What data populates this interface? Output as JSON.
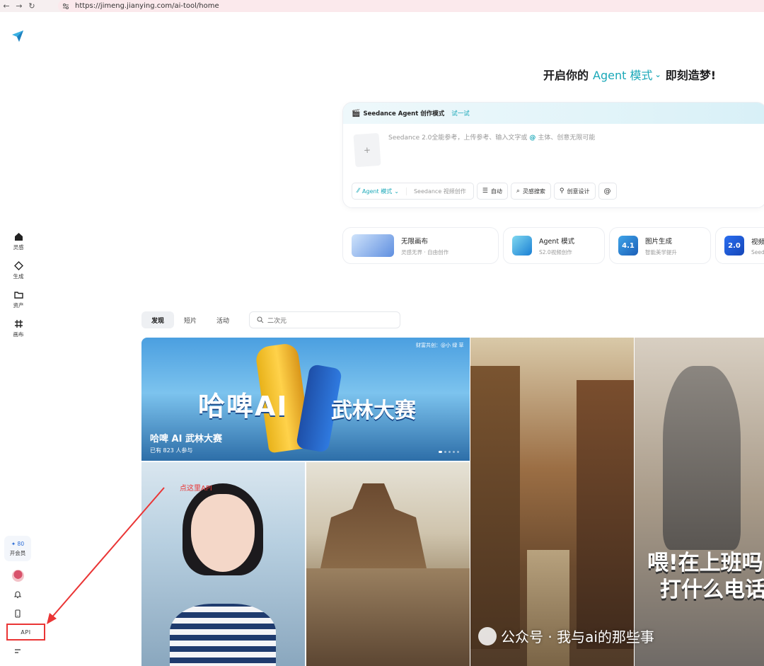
{
  "browser": {
    "url": "https://jimeng.jianying.com/ai-tool/home",
    "back_icon": "←",
    "forward_icon": "→",
    "reload_icon": "↻"
  },
  "sidebar": {
    "items": [
      {
        "label": "灵感",
        "icon": "home-icon"
      },
      {
        "label": "生成",
        "icon": "diamond-icon"
      },
      {
        "label": "资产",
        "icon": "folder-icon"
      },
      {
        "label": "画布",
        "icon": "canvas-icon"
      }
    ],
    "vip_count": "✦ 80",
    "vip_label": "开会员",
    "api_label": "API"
  },
  "hero": {
    "prefix": "开启你的",
    "accent": "Agent 模式",
    "suffix": "即刻造梦!",
    "accent_color": "#1aa8b8"
  },
  "prompt": {
    "banner_text": "Seedance Agent 创作模式",
    "banner_try": "试一试",
    "placeholder_a": "Seedance 2.0全能参考，上传参考、输入文字或",
    "placeholder_at": "@",
    "placeholder_b": "主体、创意无限可能",
    "upload_plus": "+",
    "tools": {
      "agent": "Agent 模式",
      "agent_sub": "Seedance 视频创作",
      "auto": "自动",
      "search": "灵感搜索",
      "design": "创意设计",
      "mention": "@"
    }
  },
  "features": [
    {
      "title": "无限画布",
      "sub": "灵感无界 · 自由创作"
    },
    {
      "title": "Agent 模式",
      "sub": "S2.0视频创作"
    },
    {
      "title": "图片生成",
      "sub": "智能美学提升",
      "badge": "4.1"
    },
    {
      "title": "视频",
      "sub": "Seed",
      "badge": "2.0"
    }
  ],
  "tabs": [
    "发现",
    "短片",
    "活动"
  ],
  "search": {
    "value": "二次元"
  },
  "gallery": {
    "banner_title": "哈啤 AI 武林大赛",
    "banner_sub": "已有 823 人参与",
    "banner_big_a": "哈啤AI",
    "banner_big_b": "武林大赛",
    "banner_credit": "财富共创：@小 绿 草",
    "warrior_line1": "喂!在上班吗",
    "warrior_line2": "打什么电话"
  },
  "annotation": {
    "text": "点这里API"
  },
  "watermark": {
    "text": "公众号 · 我与ai的那些事"
  }
}
